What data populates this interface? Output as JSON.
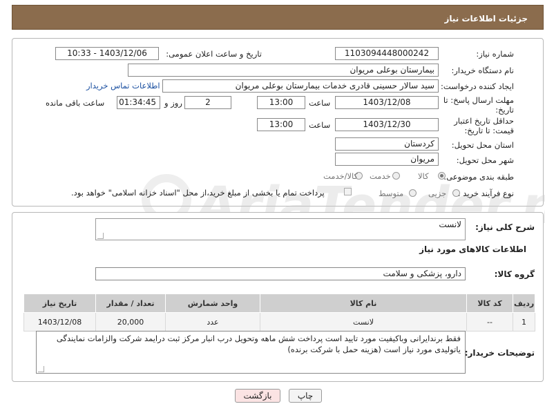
{
  "header": {
    "title": "جزئیات اطلاعات نیاز"
  },
  "form": {
    "need_number_label": "شماره نیاز:",
    "need_number": "1103094448000242",
    "announce_label": "تاریخ و ساعت اعلان عمومی:",
    "announce_value": "1403/12/06 - 10:33",
    "buyer_org_label": "نام دستگاه خریدار:",
    "buyer_org": "بیمارستان بوعلی مریوان",
    "requester_label": "ایجاد کننده درخواست:",
    "requester": "سید سالار حسینی قادری خدمات بیمارستان بوعلی مریوان",
    "contact_link": "اطلاعات تماس خریدار",
    "reply_deadline_label": "مهلت ارسال پاسخ: تا تاریخ:",
    "reply_date": "1403/12/08",
    "time_label": "ساعت",
    "reply_time": "13:00",
    "days_value": "2",
    "days_label": "روز و",
    "remaining_value": "01:34:45",
    "remaining_label": "ساعت باقی مانده",
    "price_validity_label": "حداقل تاریخ اعتبار قیمت: تا تاریخ:",
    "price_date": "1403/12/30",
    "price_time": "13:00",
    "province_label": "استان محل تحویل:",
    "province": "کردستان",
    "city_label": "شهر محل تحویل:",
    "city": "مریوان",
    "category_label": "طبقه بندی موضوعی:",
    "category_options": [
      "کالا",
      "خدمت",
      "کالا/خدمت"
    ],
    "category_selected": "کالا",
    "process_label": "نوع فرآیند خرید :",
    "process_options": [
      "جزیی",
      "متوسط"
    ],
    "payment_note": "پرداخت تمام یا بخشی از مبلغ خرید،از محل \"اسناد خزانه اسلامی\" خواهد بود."
  },
  "details": {
    "summary_label": "شرح کلی نیاز:",
    "summary_value": "لانست",
    "goods_info_title": "اطلاعات کالاهای مورد نیاز",
    "goods_group_label": "گروه کالا:",
    "goods_group": "دارو، پزشکی و سلامت",
    "table": {
      "headers": [
        "ردیف",
        "کد کالا",
        "نام کالا",
        "واحد شمارش",
        "تعداد / مقدار",
        "تاریخ نیاز"
      ],
      "rows": [
        [
          "1",
          "--",
          "لانست",
          "عدد",
          "20,000",
          "1403/12/08"
        ]
      ]
    },
    "buyer_notes_label": "توضیحات خریدار:",
    "buyer_notes": "فقط برندایرانی وباکیفیت مورد تایید است پرداخت شش ماهه وتحویل درب انبار مرکز ثبت درایمد شرکت والزامات نمایندگی یاتولیدی مورد نیاز است (هزینه حمل با شرکت برنده)"
  },
  "buttons": {
    "print": "چاپ",
    "back": "بازگشت"
  },
  "watermark": "AriaTender.neT",
  "colors": {
    "header": "#8b6c4d",
    "link": "#1a4fa0",
    "back_button": "#fbe3e3"
  }
}
